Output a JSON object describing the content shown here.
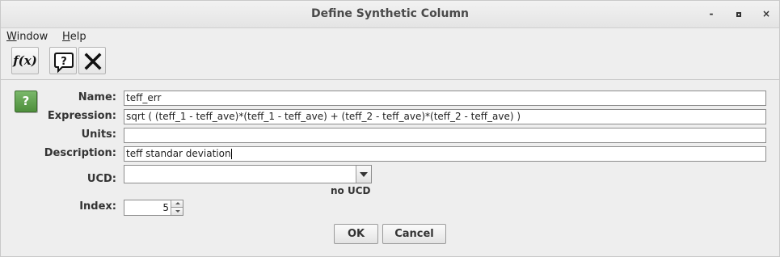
{
  "window": {
    "title": "Define Synthetic Column",
    "controls": {
      "minimize": "-",
      "close": "×"
    }
  },
  "menubar": [
    {
      "label": "Window",
      "mnemonic": "W",
      "rest": "indow"
    },
    {
      "label": "Help",
      "mnemonic": "H",
      "rest": "elp"
    }
  ],
  "toolbar": {
    "function_label": "f(x)",
    "icons": [
      "function-icon",
      "help-icon",
      "close-icon"
    ]
  },
  "help_icon": {
    "glyph": "?",
    "color": "#5a9a48"
  },
  "form": {
    "name": {
      "label": "Name:",
      "value": "teff_err"
    },
    "expression": {
      "label": "Expression:",
      "value": "sqrt ( (teff_1 - teff_ave)*(teff_1 - teff_ave) + (teff_2 - teff_ave)*(teff_2 - teff_ave) )"
    },
    "units": {
      "label": "Units:",
      "value": ""
    },
    "description": {
      "label": "Description:",
      "value": "teff standar deviation"
    },
    "ucd": {
      "label": "UCD:",
      "value": "",
      "status": "no UCD"
    },
    "index": {
      "label": "Index:",
      "value": "5"
    }
  },
  "buttons": {
    "ok": "OK",
    "cancel": "Cancel"
  }
}
